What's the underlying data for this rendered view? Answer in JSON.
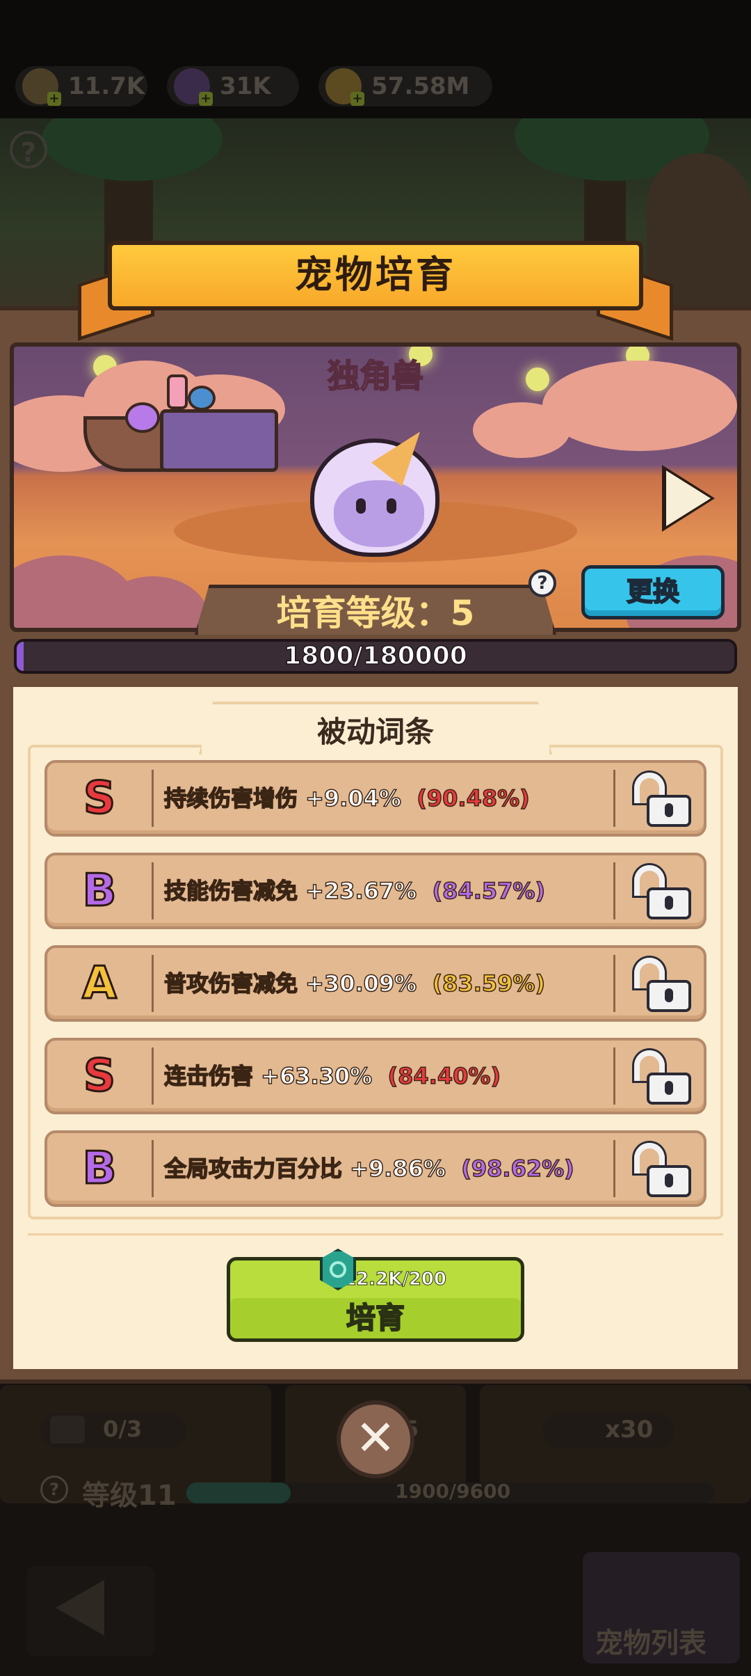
{
  "currencies": [
    {
      "icon": "egg-currency-icon",
      "value": "11.7K"
    },
    {
      "icon": "potion-currency-icon",
      "value": "31K"
    },
    {
      "icon": "gold-key-icon",
      "value": "57.58M"
    }
  ],
  "dialog": {
    "title": "宠物培育",
    "pet_name": "独角兽",
    "level_label": "培育等级：5",
    "swap_label": "更换",
    "progress_text": "1800/180000",
    "progress_fraction": 0.01,
    "passives_title": "被动词条",
    "passives": [
      {
        "grade": "S",
        "grade_color": "#e8393f",
        "text": "持续伤害增伤 +9.04%",
        "pct": "(90.48%)",
        "pct_color": "#e8393f"
      },
      {
        "grade": "B",
        "grade_color": "#b56ae8",
        "text": "技能伤害减免 +23.67%",
        "pct": "(84.57%)",
        "pct_color": "#b56ae8"
      },
      {
        "grade": "A",
        "grade_color": "#f3c13a",
        "text": "普攻伤害减免 +30.09%",
        "pct": "(83.59%)",
        "pct_color": "#f3c13a"
      },
      {
        "grade": "S",
        "grade_color": "#e8393f",
        "text": "连击伤害 +63.30%",
        "pct": "(84.40%)",
        "pct_color": "#e8393f"
      },
      {
        "grade": "B",
        "grade_color": "#b56ae8",
        "text": "全局攻击力百分比 +9.86%",
        "pct": "(98.62%)",
        "pct_color": "#b56ae8"
      }
    ],
    "breed_cost": "12.2K/200",
    "breed_label": "培育"
  },
  "background": {
    "video_counter": "0/3",
    "center_count": "5",
    "egg_count": "x30",
    "level_label": "等级11",
    "exp_text": "1900/9600",
    "pet_list_label": "宠物列表"
  }
}
